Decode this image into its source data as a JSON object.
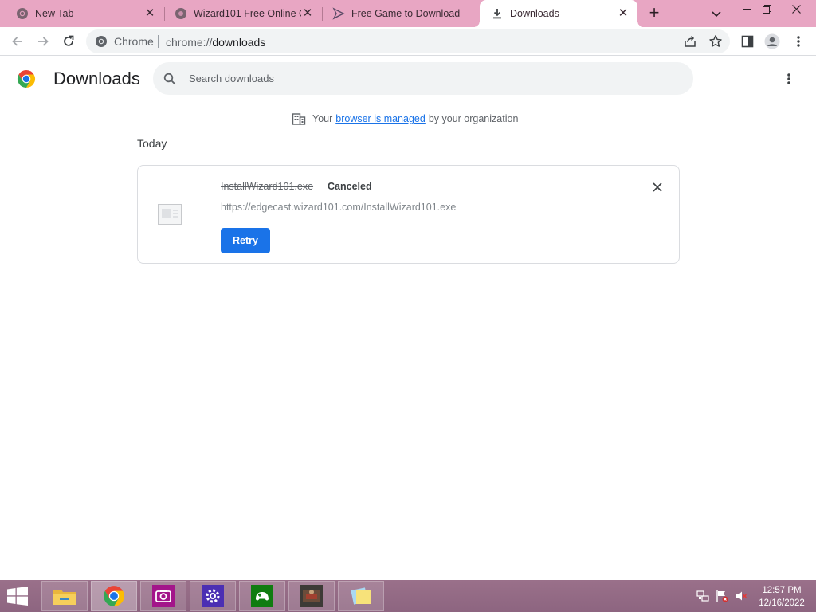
{
  "tabs": [
    {
      "title": "New Tab",
      "favicon": "chrome-favicon",
      "active": false
    },
    {
      "title": "Wizard101 Free Online G",
      "favicon": "globe-favicon",
      "active": false
    },
    {
      "title": "Free Game to Download",
      "favicon": "game-favicon",
      "active": false
    },
    {
      "title": "Downloads",
      "favicon": "download-icon",
      "active": true
    }
  ],
  "toolbar": {
    "site_label": "Chrome",
    "url_scheme": "chrome://",
    "url_path": "downloads"
  },
  "page": {
    "title": "Downloads",
    "search_placeholder": "Search downloads",
    "managed": {
      "prefix": "Your",
      "link": "browser is managed",
      "suffix": "by your organization"
    },
    "section_date": "Today"
  },
  "downloads": [
    {
      "filename": "InstallWizard101.exe",
      "status": "Canceled",
      "url": "https://edgecast.wizard101.com/InstallWizard101.exe",
      "action": "Retry"
    }
  ],
  "taskbar": {
    "apps": [
      "file-explorer",
      "chrome",
      "camera",
      "settings",
      "xbox",
      "game",
      "sticky-notes"
    ],
    "time": "12:57 PM",
    "date": "12/16/2022"
  },
  "colors": {
    "tabstrip": "#e8a6c3",
    "accent": "#1a73e8",
    "taskbar": "#8d6580"
  }
}
